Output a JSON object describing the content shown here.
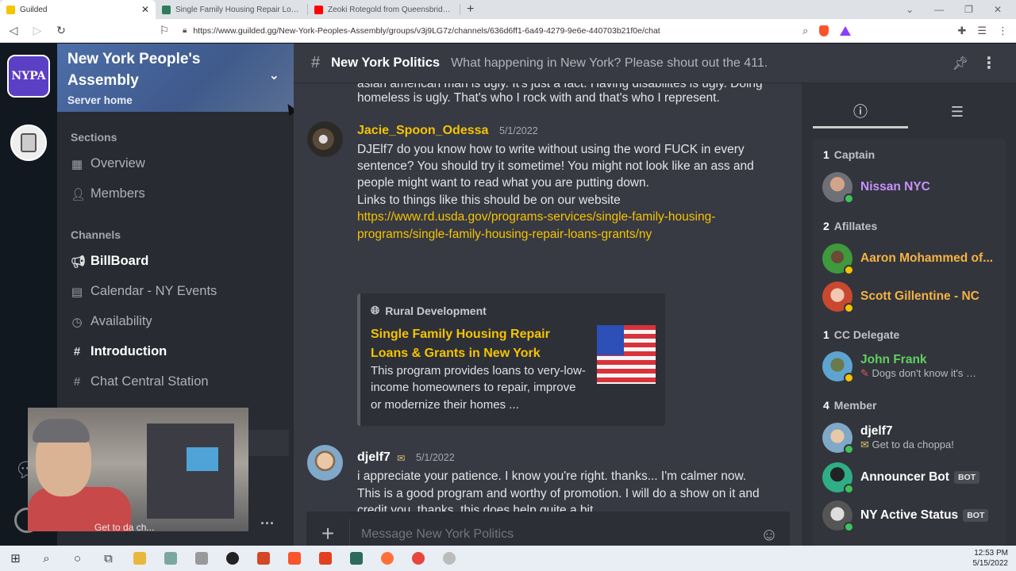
{
  "browser": {
    "tabs": [
      {
        "title": "Guilded",
        "active": true,
        "color": "#f5c400"
      },
      {
        "title": "Single Family Housing Repair Loans &",
        "active": false,
        "color": "#2e7d5b"
      },
      {
        "title": "Zeoki Rotegold from Queensbridge Pr",
        "active": false,
        "color": "#ff0000"
      }
    ],
    "new_tab": "+",
    "url": "https://www.guilded.gg/New-York-Peoples-Assembly/groups/v3j9LG7z/channels/636d6ff1-6a49-4279-9e6e-440703b21f0e/chat"
  },
  "server": {
    "icon_label": "NYPA",
    "name": "New York People's Assembly",
    "subtitle": "Server home"
  },
  "sidebar": {
    "sections_label": "Sections",
    "sections": [
      {
        "label": "Overview",
        "icon": "grid-icon"
      },
      {
        "label": "Members",
        "icon": "members-icon"
      }
    ],
    "channels_label": "Channels",
    "channels": [
      {
        "label": "BillBoard",
        "icon": "megaphone-icon",
        "bold": true
      },
      {
        "label": "Calendar - NY Events",
        "icon": "calendar-icon",
        "bold": false
      },
      {
        "label": "Availability",
        "icon": "clock-icon",
        "bold": false
      },
      {
        "label": "Introduction",
        "icon": "hash-icon",
        "bold": true
      },
      {
        "label": "Chat Central Station",
        "icon": "hash-icon",
        "bold": false
      }
    ],
    "more": "...",
    "webcam_caption": "Get to da ch..."
  },
  "channel": {
    "name": "New York Politics",
    "topic": "What happening in New York? Please shout out the 411."
  },
  "messages": {
    "partial_line_1": "asian american man is ugly. It's just a fact. Having disabilites is ugly. Doing",
    "partial_line_2": "homeless is ugly. That's who I rock with and that's who I represent.",
    "msg1": {
      "author": "Jacie_Spoon_Odessa",
      "author_color": "#f5c400",
      "date": "5/1/2022",
      "lines": [
        "DJElf7 do you know how to write without using the word FUCK in every",
        "sentence? You should try it sometime! You might not look like an ass and",
        "people might want to read what you are putting down.",
        "Links to things like this should be on our website"
      ],
      "link_lines": [
        "https://www.rd.usda.gov/programs-services/single-family-housing-",
        "programs/single-family-housing-repair-loans-grants/ny"
      ],
      "embed": {
        "site": "Rural Development",
        "title": "Single Family Housing Repair Loans & Grants in New York",
        "description": "This program provides loans to very-low-income homeowners to repair, improve or modernize their homes ..."
      }
    },
    "msg2": {
      "author": "djelf7",
      "author_color": "#ffffff",
      "date": "5/1/2022",
      "lines": [
        "i appreciate your patience. I know you're right. thanks... I'm calmer now.",
        "This is a good program and worthy of promotion. I will do a show on it and",
        "credit you. thanks. this does help quite a bit."
      ]
    }
  },
  "composer": {
    "placeholder": "Message New York Politics"
  },
  "right_panel": {
    "roles": [
      {
        "count": "1",
        "name": "Captain"
      },
      {
        "count": "2",
        "name": "Afillates"
      },
      {
        "count": "1",
        "name": "CC Delegate"
      },
      {
        "count": "4",
        "name": "Member"
      }
    ],
    "members": [
      {
        "name": "Nissan NYC",
        "color": "#c792ff",
        "status_color": "#3cc45a",
        "sub": ""
      },
      {
        "name": "Aaron Mohammed of...",
        "color": "#f5b342",
        "status_color": "#f5c400",
        "sub": ""
      },
      {
        "name": "Scott Gillentine - NC",
        "color": "#f5b342",
        "status_color": "#f5c400",
        "sub": ""
      },
      {
        "name": "John Frank",
        "color": "#5fd15f",
        "status_color": "#f5c400",
        "sub": "Dogs don't know it's n..."
      },
      {
        "name": "djelf7",
        "color": "#ffffff",
        "status_color": "#3cc45a",
        "sub": "Get to da choppa!"
      },
      {
        "name": "Announcer Bot",
        "color": "#ffffff",
        "status_color": "#3cc45a",
        "sub": "",
        "badge": "BOT"
      },
      {
        "name": "NY Active Status",
        "color": "#ffffff",
        "status_color": "#3cc45a",
        "sub": "",
        "badge": "BOT"
      }
    ]
  },
  "taskbar": {
    "time": "12:53 PM",
    "date": "5/15/2022"
  }
}
